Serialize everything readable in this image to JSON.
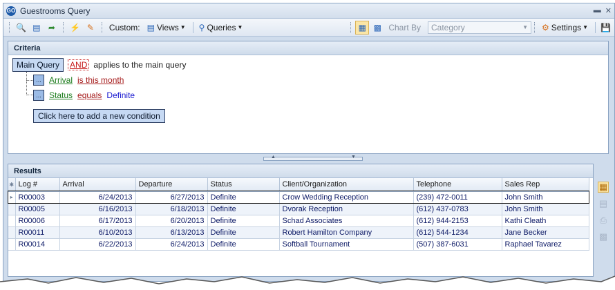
{
  "window": {
    "title": "Guestrooms Query",
    "app_badge": "GO"
  },
  "toolbar": {
    "custom_label": "Custom:",
    "views_label": "Views",
    "queries_label": "Queries",
    "chart_by_label": "Chart By",
    "chart_by_value": "Category",
    "settings_label": "Settings"
  },
  "criteria": {
    "header": "Criteria",
    "main_query_label": "Main Query",
    "and_label": "AND",
    "applies_text": "applies to the main query",
    "ellipsis": "...",
    "conditions": [
      {
        "field": "Arrival",
        "operator": "is this month",
        "value": ""
      },
      {
        "field": "Status",
        "operator": "equals",
        "value": "Definite"
      }
    ],
    "add_condition_label": "Click here to add a new condition"
  },
  "results": {
    "header": "Results",
    "columns": [
      "Log #",
      "Arrival",
      "Departure",
      "Status",
      "Client/Organization",
      "Telephone",
      "Sales Rep"
    ],
    "rows": [
      [
        "R00003",
        "6/24/2013",
        "6/27/2013",
        "Definite",
        "Crow Wedding Reception",
        "(239) 472-0011",
        "John Smith"
      ],
      [
        "R00005",
        "6/16/2013",
        "6/18/2013",
        "Definite",
        "Dvorak Reception",
        "(612) 437-0783",
        "John Smith"
      ],
      [
        "R00006",
        "6/17/2013",
        "6/20/2013",
        "Definite",
        "Schad Associates",
        "(612) 944-2153",
        "Kathi Cleath"
      ],
      [
        "R00011",
        "6/10/2013",
        "6/13/2013",
        "Definite",
        "Robert Hamilton Company",
        "(612) 544-1234",
        "Jane Becker"
      ],
      [
        "R00014",
        "6/22/2013",
        "6/24/2013",
        "Definite",
        "Softball Tournament",
        "(507) 387-6031",
        "Raphael Tavarez"
      ]
    ]
  },
  "icons": {
    "print_preview": "print-preview-icon",
    "grid_view": "grid-view-icon",
    "chart": "chart-icon"
  }
}
